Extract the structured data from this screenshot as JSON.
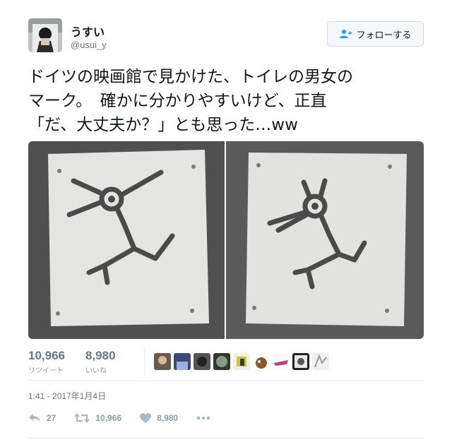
{
  "user": {
    "display_name": "うすい",
    "screen_name": "@usui_y"
  },
  "follow_button": {
    "label": "フォローする"
  },
  "tweet": {
    "text": "ドイツの映画館で見かけた、トイレの男女の\nマーク。　確かに分かりやすいけど、正直\n「だ、大丈夫か？」とも思った…ww"
  },
  "stats": {
    "retweets": "10,966",
    "retweets_label": "リツイート",
    "likes": "8,980",
    "likes_label": "いいね"
  },
  "timestamp": "1:41 - 2017年1月4日",
  "actions": {
    "reply_count": "27",
    "retweet_count": "10,966",
    "like_count": "8,980"
  },
  "colors": {
    "text": "#14171a",
    "secondary": "#657786",
    "muted": "#8899a6",
    "border": "#e6ecf0"
  }
}
